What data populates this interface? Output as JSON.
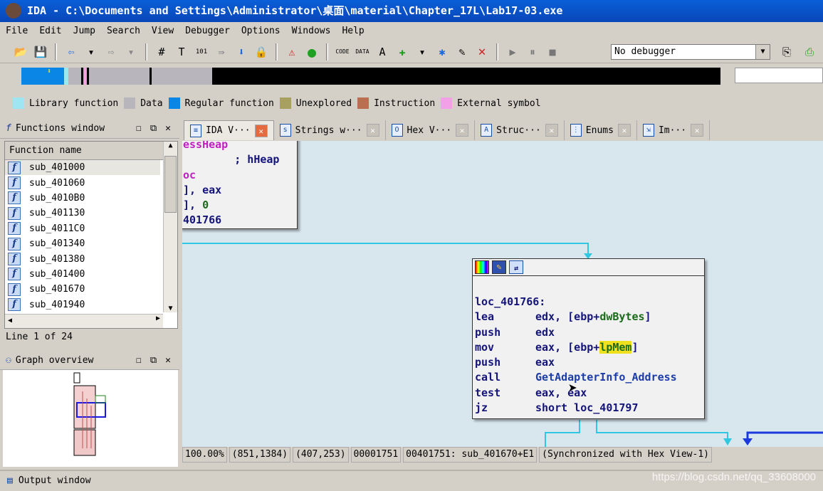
{
  "window": {
    "title": "IDA - C:\\Documents and Settings\\Administrator\\桌面\\material\\Chapter_17L\\Lab17-03.exe"
  },
  "menu": [
    "File",
    "Edit",
    "Jump",
    "Search",
    "View",
    "Debugger",
    "Options",
    "Windows",
    "Help"
  ],
  "toolbar": {
    "debugger_select": "No debugger"
  },
  "legend": [
    {
      "label": "Library function",
      "color": "#9de6f2"
    },
    {
      "label": "Data",
      "color": "#b8b6bc"
    },
    {
      "label": "Regular function",
      "color": "#0a86e6"
    },
    {
      "label": "Unexplored",
      "color": "#a8a060"
    },
    {
      "label": "Instruction",
      "color": "#b87050"
    },
    {
      "label": "External symbol",
      "color": "#f4a0e8"
    }
  ],
  "functions_window": {
    "title": "Functions window",
    "column": "Function name",
    "items": [
      "sub_401000",
      "sub_401060",
      "sub_4010B0",
      "sub_401130",
      "sub_4011C0",
      "sub_401340",
      "sub_401380",
      "sub_401400",
      "sub_401670",
      "sub_401940"
    ],
    "line_info": "Line 1 of 24"
  },
  "graph_overview": {
    "title": "Graph overview"
  },
  "tabs": [
    {
      "label": "IDA V···",
      "icon": "ida-view-icon"
    },
    {
      "label": "Strings w···",
      "icon": "strings-icon"
    },
    {
      "label": "Hex V···",
      "icon": "hex-icon"
    },
    {
      "label": "Struc···",
      "icon": "structures-icon"
    },
    {
      "label": "Enums",
      "icon": "enums-icon"
    },
    {
      "label": "Im···",
      "icon": "imports-icon"
    }
  ],
  "graph": {
    "partial_node": [
      "essHeap",
      "        ; hHeap",
      "oc",
      "], eax",
      "], 0",
      "401766"
    ],
    "node": {
      "label": "loc_401766:",
      "lines": [
        {
          "mn": "lea",
          "op1": "edx, [ebp+",
          "var": "dwBytes",
          "op2": "]"
        },
        {
          "mn": "push",
          "op1": "edx"
        },
        {
          "mn": "mov",
          "op1": "eax, [ebp+",
          "var": "lpMem",
          "op2": "]"
        },
        {
          "mn": "push",
          "op1": "eax"
        },
        {
          "mn": "call",
          "fn": "GetAdapterInfo_Address"
        },
        {
          "mn": "test",
          "op1": "eax, eax"
        },
        {
          "mn": "jz",
          "op1": "short loc_401797"
        }
      ]
    }
  },
  "status": [
    "100.00%",
    "(851,1384)",
    "(407,253)",
    "00001751",
    "00401751: sub_401670+E1",
    "(Synchronized with Hex View-1)"
  ],
  "output_window": {
    "title": "Output window"
  },
  "watermark": "https://blog.csdn.net/qq_33608000"
}
